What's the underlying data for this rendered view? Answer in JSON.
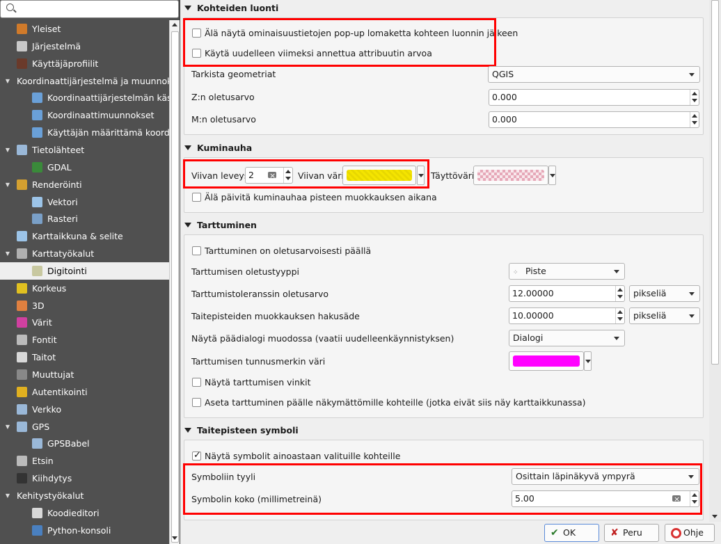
{
  "search": {
    "placeholder": ""
  },
  "sidebar": {
    "items": [
      {
        "label": "Yleiset",
        "icon": "wrench-icon",
        "color": "#d07a2a"
      },
      {
        "label": "Järjestelmä",
        "icon": "gears-icon",
        "color": "#c9c9c9"
      },
      {
        "label": "Käyttäjäprofiilit",
        "icon": "user-icon",
        "color": "#6a3a2a"
      },
      {
        "label": "Koordinaattijärjestelmä ja muunnokset",
        "icon": "expand-arrow",
        "color": ""
      },
      {
        "label": "Koordinaattijärjestelmän käsittely",
        "icon": "globe-icon",
        "color": "#6aa0d8"
      },
      {
        "label": "Koordinaattimuunnokset",
        "icon": "globe-transform-icon",
        "color": "#6aa0d8"
      },
      {
        "label": "Käyttäjän määrittämä koordinaatisto",
        "icon": "globe-star-icon",
        "color": "#6aa0d8"
      },
      {
        "label": "Tietolähteet",
        "icon": "table-icon",
        "color": "#9ab8d8"
      },
      {
        "label": "GDAL",
        "icon": "gdal-globe-icon",
        "color": "#3a8a3a"
      },
      {
        "label": "Renderöinti",
        "icon": "paintbrush-icon",
        "color": "#d4a030"
      },
      {
        "label": "Vektori",
        "icon": "vector-icon",
        "color": "#9cc4e8"
      },
      {
        "label": "Rasteri",
        "icon": "raster-icon",
        "color": "#7aa0c8"
      },
      {
        "label": "Karttaikkuna & selite",
        "icon": "map-canvas-icon",
        "color": "#9cc4e8"
      },
      {
        "label": "Karttatyökalut",
        "icon": "map-tools-icon",
        "color": "#b0b0b0"
      },
      {
        "label": "Digitointi",
        "icon": "digitize-icon",
        "color": "#c8c8a0"
      },
      {
        "label": "Korkeus",
        "icon": "elevation-icon",
        "color": "#e0c020"
      },
      {
        "label": "3D",
        "icon": "cube-icon",
        "color": "#e08040"
      },
      {
        "label": "Värit",
        "icon": "palette-icon",
        "color": "#d040a0"
      },
      {
        "label": "Fontit",
        "icon": "font-icon",
        "color": "#bbbbbb"
      },
      {
        "label": "Taitot",
        "icon": "layout-icon",
        "color": "#d8d8d8"
      },
      {
        "label": "Muuttujat",
        "icon": "epsilon-icon",
        "color": "#888888"
      },
      {
        "label": "Autentikointi",
        "icon": "lock-icon",
        "color": "#e0b020"
      },
      {
        "label": "Verkko",
        "icon": "network-icon",
        "color": "#9ab8d8"
      },
      {
        "label": "GPS",
        "icon": "gps-icon",
        "color": "#9ab8d8"
      },
      {
        "label": "GPSBabel",
        "icon": "gpsbabel-icon",
        "color": "#9ab8d8"
      },
      {
        "label": "Etsin",
        "icon": "search-icon",
        "color": "#bbbbbb"
      },
      {
        "label": "Kiihdytys",
        "icon": "acceleration-icon",
        "color": "#333333"
      },
      {
        "label": "Kehitystyökalut",
        "icon": "expand-arrow",
        "color": ""
      },
      {
        "label": "Koodieditori",
        "icon": "code-editor-icon",
        "color": "#d8d8d8"
      },
      {
        "label": "Python-konsoli",
        "icon": "python-icon",
        "color": "#4a80c0"
      }
    ]
  },
  "groups": {
    "creation": {
      "title": "Kohteiden luonti",
      "suppress_popup": "Älä näytä ominaisuustietojen pop-up lomaketta kohteen luonnin jälkeen",
      "reuse_attr": "Käytä uudelleen viimeksi annettua attribuutin arvoa",
      "validate_label": "Tarkista geometriat",
      "validate_value": "QGIS",
      "z_label": "Z:n oletusarvo",
      "z_value": "0.000",
      "m_label": "M:n oletusarvo",
      "m_value": "0.000"
    },
    "rubberband": {
      "title": "Kuminauha",
      "line_width_label": "Viivan leveys",
      "line_width_value": "2",
      "line_color_label": "Viivan väri",
      "line_color": "#f2e40a",
      "fill_color_label": "Täyttöväri",
      "fill_color": "#e8a8b8",
      "no_update": "Älä päivitä kuminauhaa pisteen muokkauksen aikana"
    },
    "snapping": {
      "title": "Tarttuminen",
      "enabled_default": "Tarttuminen on oletusarvoisesti päällä",
      "type_label": "Tarttumisen oletustyyppi",
      "type_value": "Piste",
      "tolerance_label": "Tarttumistoleranssin oletusarvo",
      "tolerance_value": "12.00000",
      "tolerance_unit": "pikseliä",
      "search_label": "Taitepisteiden muokkauksen hakusäde",
      "search_value": "10.00000",
      "search_unit": "pikseliä",
      "dialog_label": "Näytä päädialogi muodossa (vaatii uudelleenkäynnistyksen)",
      "dialog_value": "Dialogi",
      "marker_color_label": "Tarttumisen tunnusmerkin väri",
      "marker_color": "#ff00ff",
      "show_tips": "Näytä tarttumisen vinkit",
      "invisible": "Aseta tarttuminen päälle näkymättömille kohteille (jotka eivät siis näy karttaikkunassa)"
    },
    "vertex": {
      "title": "Taitepisteen symboli",
      "only_selected": "Näytä symbolit ainoastaan valituille kohteille",
      "only_selected_checked": true,
      "style_label": "Symboliin tyyli",
      "style_value": "Osittain läpinäkyvä ympyrä",
      "size_label": "Symbolin koko (millimetreinä)",
      "size_value": "5.00"
    }
  },
  "buttons": {
    "ok": "OK",
    "cancel": "Peru",
    "help": "Ohje"
  }
}
